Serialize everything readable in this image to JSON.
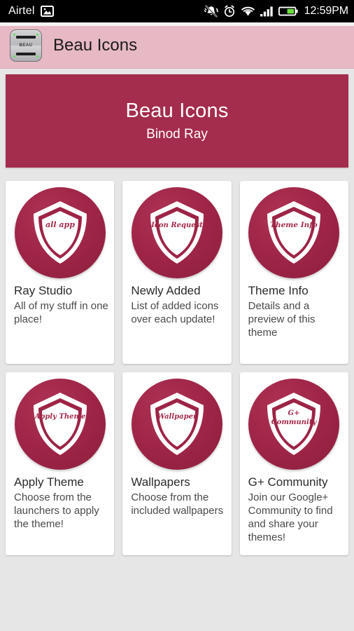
{
  "status_bar": {
    "carrier": "Airtel",
    "icons": [
      "image-icon",
      "mute-bell-icon",
      "alarm-icon",
      "wifi-icon",
      "signal-icon",
      "battery-icon"
    ],
    "time": "12:59PM"
  },
  "app_bar": {
    "icon_label": "BEAU",
    "title": "Beau Icons",
    "background_color": "#e7b9c4"
  },
  "hero": {
    "title": "Beau Icons",
    "subtitle": "Binod Ray",
    "background_color": "#a42c4c"
  },
  "cards": [
    {
      "shield_text": "all app",
      "shield_text_2": "",
      "title": "Ray Studio",
      "description": "All of my stuff in one place!"
    },
    {
      "shield_text": "Icon Request",
      "shield_text_2": "",
      "title": "Newly Added",
      "description": "List of added icons over each update!"
    },
    {
      "shield_text": "Theme Info",
      "shield_text_2": "",
      "title": "Theme Info",
      "description": "Details and a preview of this theme"
    },
    {
      "shield_text": "Apply Theme",
      "shield_text_2": "",
      "title": "Apply Theme",
      "description": "Choose from the launchers to apply the theme!"
    },
    {
      "shield_text": "Wallpaper",
      "shield_text_2": "",
      "title": "Wallpapers",
      "description": "Choose from the included wallpapers"
    },
    {
      "shield_text": "G+",
      "shield_text_2": "Community",
      "title": "G+ Community",
      "description": "Join our Google+ Community to find and share your themes!"
    }
  ],
  "colors": {
    "accent": "#a42c4c",
    "app_bar": "#e7b9c4",
    "background": "#e6e6e6",
    "card": "#ffffff"
  }
}
